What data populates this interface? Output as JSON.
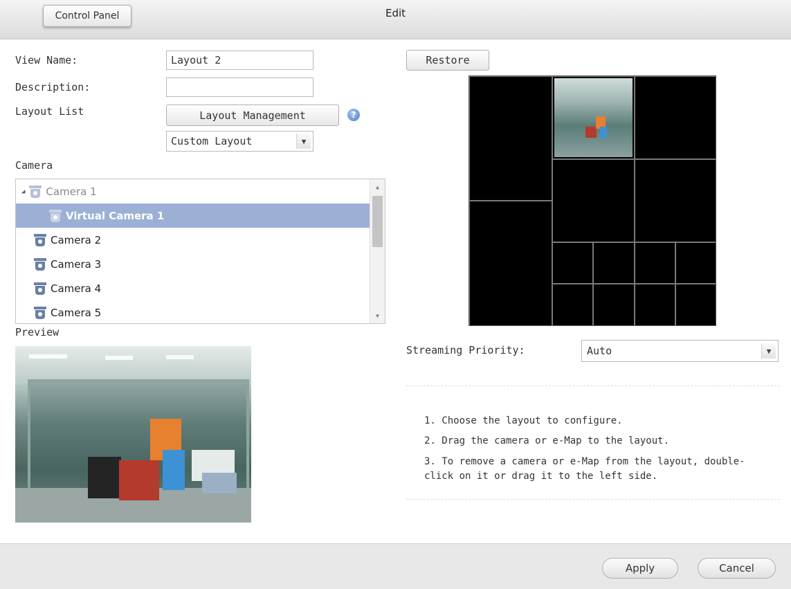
{
  "header": {
    "control_panel_label": "Control Panel",
    "title": "Edit"
  },
  "form": {
    "view_name_label": "View Name:",
    "view_name_value": "Layout 2",
    "description_label": "Description:",
    "description_value": "",
    "layout_list_label": "Layout List",
    "layout_management_label": "Layout Management",
    "layout_select_value": "Custom Layout",
    "camera_label": "Camera",
    "preview_label": "Preview"
  },
  "camera_tree": [
    {
      "label": "Camera 1",
      "state": "expanded-dim"
    },
    {
      "label": "Virtual Camera 1",
      "state": "selected"
    },
    {
      "label": "Camera 2",
      "state": "normal"
    },
    {
      "label": "Camera 3",
      "state": "normal"
    },
    {
      "label": "Camera 4",
      "state": "normal"
    },
    {
      "label": "Camera 5",
      "state": "normal"
    }
  ],
  "layout_panel": {
    "restore_label": "Restore",
    "streaming_priority_label": "Streaming Priority:",
    "streaming_priority_value": "Auto"
  },
  "instructions": [
    "1. Choose the layout to configure.",
    "2. Drag the camera or e-Map to the layout.",
    "3. To remove a camera or e-Map from the layout, double-click on it or drag it to the left side."
  ],
  "footer": {
    "apply_label": "Apply",
    "cancel_label": "Cancel"
  },
  "colors": {
    "selection": "#9cb0d5",
    "camera_icon": "#6a7fa8",
    "help_icon": "#4a7cc0"
  }
}
